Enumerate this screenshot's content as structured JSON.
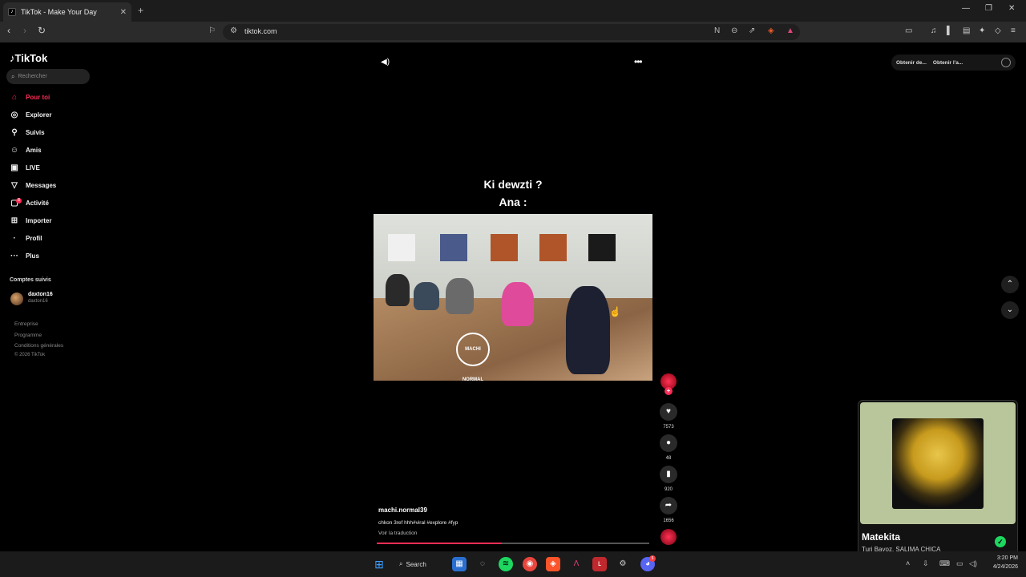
{
  "browser": {
    "tab_title": "TikTok - Make Your Day",
    "tab_close": "✕",
    "new_tab": "+",
    "url": "tiktok.com",
    "window_controls": [
      "—",
      "❐",
      "✕"
    ]
  },
  "sidebar": {
    "logo": "TikTok",
    "search_placeholder": "Rechercher",
    "items": [
      {
        "label": "Pour toi",
        "icon": "home-icon",
        "glyph": "⌂",
        "active": true
      },
      {
        "label": "Explorer",
        "icon": "compass-icon",
        "glyph": "◎"
      },
      {
        "label": "Suivis",
        "icon": "user-follow-icon",
        "glyph": "⚲"
      },
      {
        "label": "Amis",
        "icon": "friends-icon",
        "glyph": "☺"
      },
      {
        "label": "LIVE",
        "icon": "live-icon",
        "glyph": "▣"
      },
      {
        "label": "Messages",
        "icon": "send-icon",
        "glyph": "▽"
      },
      {
        "label": "Activité",
        "icon": "activity-icon",
        "glyph": "▢"
      },
      {
        "label": "Importer",
        "icon": "upload-icon",
        "glyph": "⊞"
      },
      {
        "label": "Profil",
        "icon": "profile-icon",
        "glyph": "·"
      },
      {
        "label": "Plus",
        "icon": "more-icon",
        "glyph": "···"
      }
    ],
    "activity_badge": "8",
    "followed_title": "Comptes suivis",
    "followed_accounts": [
      {
        "name": "daxton16",
        "handle": "daxton16"
      }
    ],
    "footer": [
      "Entreprise",
      "Programme",
      "Conditions générales",
      "© 2026 TikTok"
    ]
  },
  "topbar": {
    "get_coins": "Obtenir de...",
    "get_app": "Obtenir l'a..."
  },
  "video": {
    "caption_line1": "Ki dewzti ?",
    "caption_line2": "Ana :",
    "watermark": "MACHI NORMAL",
    "username": "machi.normal39",
    "description": "chkon 3ref hhh#viral #explore #fyp",
    "translate": "Voir la traduction",
    "progress": 0.46
  },
  "actions": {
    "likes": "7573",
    "comments": "48",
    "saves": "920",
    "shares": "1656"
  },
  "media_player": {
    "title": "Matekita",
    "artist": "Turi Bayoz, SALIMA CHICA"
  },
  "taskbar": {
    "search": "Search",
    "time": "3:20 PM",
    "date": "4/24/2026",
    "discord_badge": "5"
  },
  "colors": {
    "accent": "#fe2c55",
    "background": "#000000",
    "spotify": "#1ed760"
  }
}
